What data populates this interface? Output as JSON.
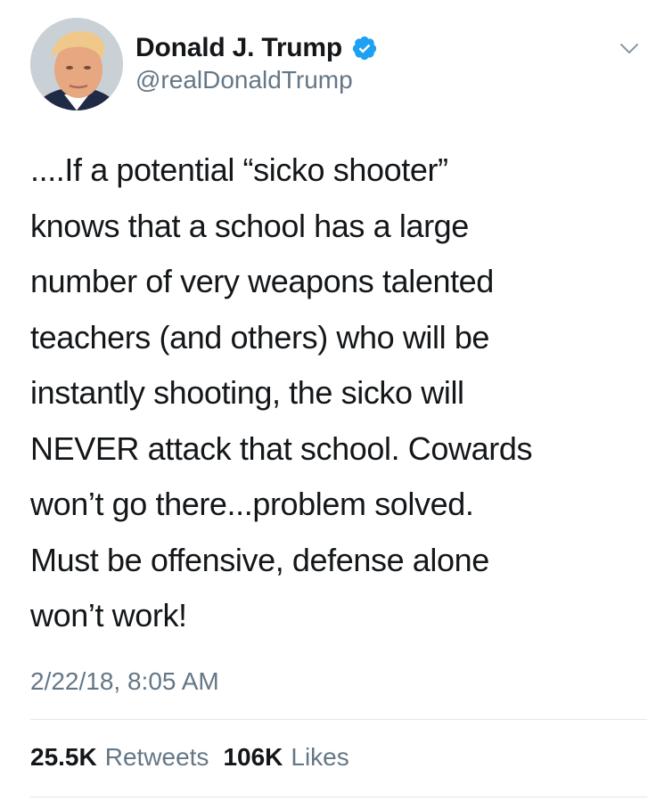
{
  "tweet": {
    "author": {
      "display_name": "Donald J. Trump",
      "handle": "@realDonaldTrump",
      "verified": true,
      "verified_color": "#1da1f2"
    },
    "text": "....If a potential “sicko shooter”\nknows that a school has a large\nnumber of very weapons talented\nteachers (and others) who will be\ninstantly shooting, the sicko will\nNEVER attack that school. Cowards\nwon’t go there...problem solved.\nMust be offensive, defense alone\nwon’t work!",
    "timestamp": "2/22/18, 8:05 AM",
    "stats": {
      "retweets_count": "25.5K",
      "retweets_label": "Retweets",
      "likes_count": "106K",
      "likes_label": "Likes"
    }
  },
  "icons": {
    "verified": "verified-badge-icon",
    "menu": "chevron-down-icon"
  },
  "colors": {
    "text_primary": "#14171a",
    "text_secondary": "#657786",
    "divider": "#e1e8ed",
    "brand_blue": "#1da1f2"
  }
}
